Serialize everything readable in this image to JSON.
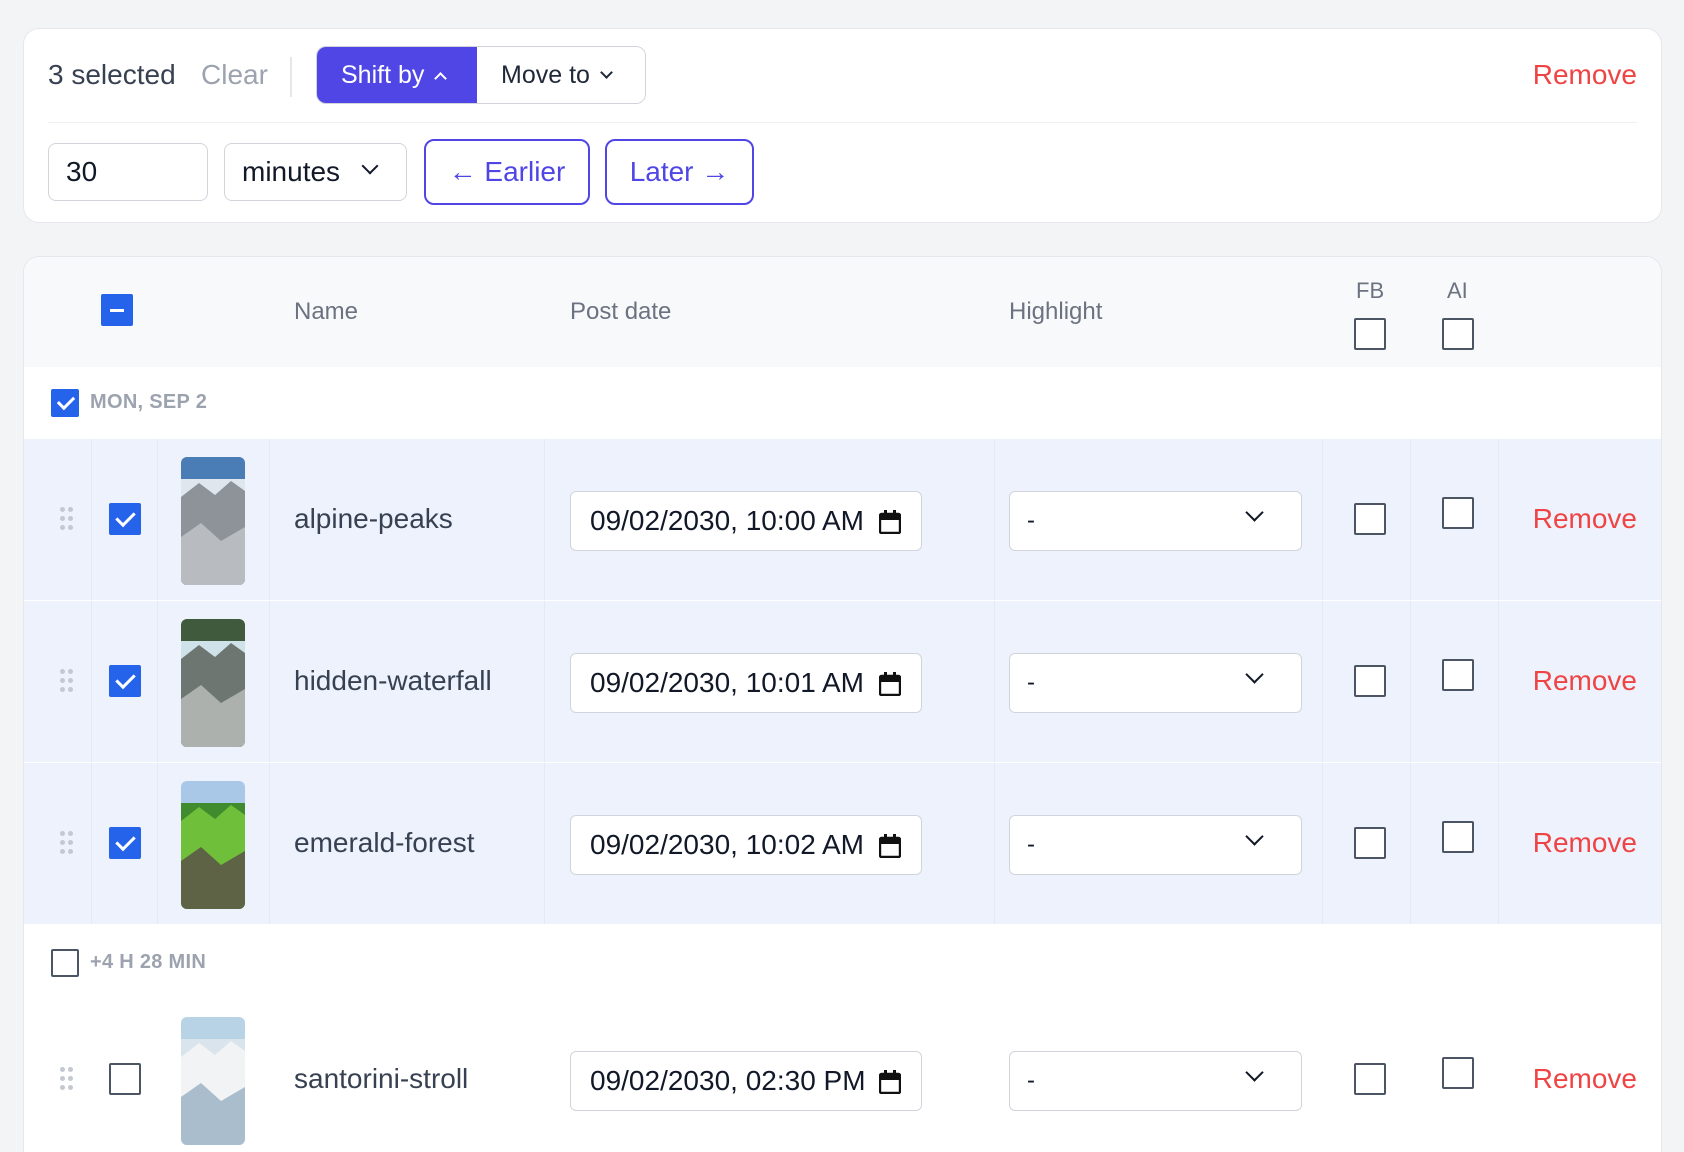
{
  "toolbar": {
    "selected_text": "3 selected",
    "clear_label": "Clear",
    "shift_by_label": "Shift by",
    "move_to_label": "Move to",
    "remove_label": "Remove",
    "amount_value": "30",
    "unit_value": "minutes",
    "earlier_label": "← Earlier",
    "later_label": "Later →"
  },
  "table": {
    "headers": {
      "name": "Name",
      "post_date": "Post date",
      "highlight": "Highlight",
      "fb": "FB",
      "ai": "AI"
    },
    "select_all_state": "indeterminate",
    "groups": [
      {
        "label": "MON, SEP 2",
        "checked": true,
        "rows": [
          {
            "name": "alpine-peaks",
            "date": "09/02/2030, 10:00 AM",
            "highlight": "-",
            "selected": true,
            "fb": false,
            "ai": false,
            "remove_label": "Remove",
            "thumb_colors": [
              "#4a7cb5",
              "#dfe6ee",
              "#8e9299",
              "#bfc2c5"
            ]
          },
          {
            "name": "hidden-waterfall",
            "date": "09/02/2030, 10:01 AM",
            "highlight": "-",
            "selected": true,
            "fb": false,
            "ai": false,
            "remove_label": "Remove",
            "thumb_colors": [
              "#3f5a3d",
              "#cfe2ea",
              "#6d7670",
              "#b8bcb8"
            ]
          },
          {
            "name": "emerald-forest",
            "date": "09/02/2030, 10:02 AM",
            "highlight": "-",
            "selected": true,
            "fb": false,
            "ai": false,
            "remove_label": "Remove",
            "thumb_colors": [
              "#a9c7e6",
              "#3f8b2e",
              "#6fbf3a",
              "#5b5246"
            ]
          }
        ]
      },
      {
        "label": "+4 H 28 MIN",
        "checked": false,
        "rows": [
          {
            "name": "santorini-stroll",
            "date": "09/02/2030, 02:30 PM",
            "highlight": "-",
            "selected": false,
            "fb": false,
            "ai": false,
            "remove_label": "Remove",
            "thumb_colors": [
              "#b9d3e6",
              "#d9e4ec",
              "#f1f3f4",
              "#9eb3c4"
            ]
          }
        ]
      }
    ]
  },
  "colors": {
    "accent": "#4f46e5",
    "checkbox_blue": "#2563eb",
    "danger": "#ef4444",
    "selected_row_bg": "#edf2fd"
  },
  "icons": [
    "chevron-up-icon",
    "chevron-down-icon",
    "calendar-icon",
    "drag-handle-icon",
    "checkbox"
  ]
}
